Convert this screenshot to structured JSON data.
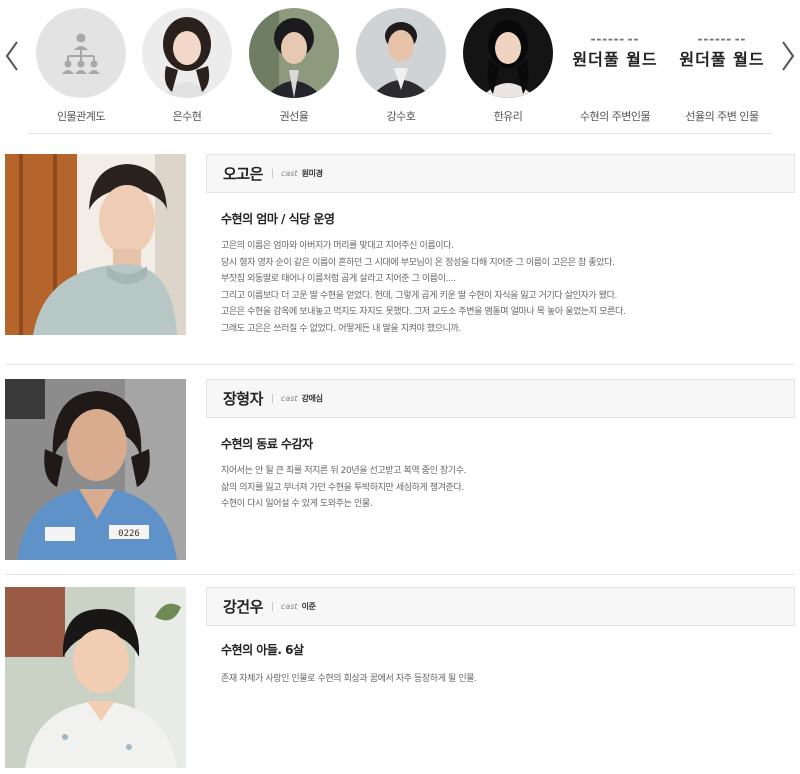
{
  "carousel": {
    "items": [
      {
        "label": "인물관계도",
        "icon": "org-chart-icon"
      },
      {
        "label": "은수현"
      },
      {
        "label": "권선율"
      },
      {
        "label": "강수호"
      },
      {
        "label": "한유리"
      },
      {
        "label": "수현의 주변인물",
        "logo": "원더풀 월드"
      },
      {
        "label": "선율의 주변 인물",
        "logo": "원더풀 월드"
      }
    ],
    "prev_icon": "chevron-left-icon",
    "next_icon": "chevron-right-icon"
  },
  "characters": [
    {
      "name": "오고은",
      "cast_label": "cast",
      "cast": "원미경",
      "role": "수현의 엄마 / 식당 운영",
      "desc": [
        "고은의 이름은 엄마와 아버지가 머리를 맞대고 지어주신 이름이다.",
        "당시 형자 영자 순이 같은 이름이 흔하던 그 시대에 부모님이 온 정성을 다해 지어준 그 이름이 고은은 참 좋았다.",
        "부잣집 외동딸로 태어나 이름처럼 곱게 살라고 지어준 그 이름이....",
        "그리고 이름보다 더 고운 딸 수현을 얻었다. 헌데, 그렇게 곱게 키운 딸 수현이 자식을 잃고 거기다 살인자가 됐다.",
        "고은은 수현을 감옥에 보내놓고 먹지도 자지도 못했다. 그저 교도소 주변을 맴돌며 얼마나 목 놓아 울었는지 모른다.",
        "그래도 고은은 쓰러질 수 없었다. 어떻게든 내 딸을 지켜야 했으니까."
      ]
    },
    {
      "name": "장형자",
      "cast_label": "cast",
      "cast": "강애심",
      "role": "수현의 동료 수감자",
      "desc": [
        "지어서는 안 될 큰 죄를 저지른 뒤 20년을 선고받고 복역 중인 장기수.",
        "삶의 의지를 잃고 무너져 가던 수현을 투박하지만 세심하게 챙겨준다.",
        "수현이 다시 일어설 수 있게 도와주는 인물."
      ]
    },
    {
      "name": "강건우",
      "cast_label": "cast",
      "cast": "이준",
      "role": "수현의 아들. 6살",
      "desc": [
        "존재 자체가 사랑인 인물로 수현의 회상과 꿈에서 자주 등장하게 될 인물."
      ]
    }
  ],
  "colors": {
    "name_bar_bg": "#f7f7f7",
    "divider": "#e6e6e6",
    "chart_circle_bg": "#e3e3e3",
    "chart_icon": "#a8a8a8"
  }
}
